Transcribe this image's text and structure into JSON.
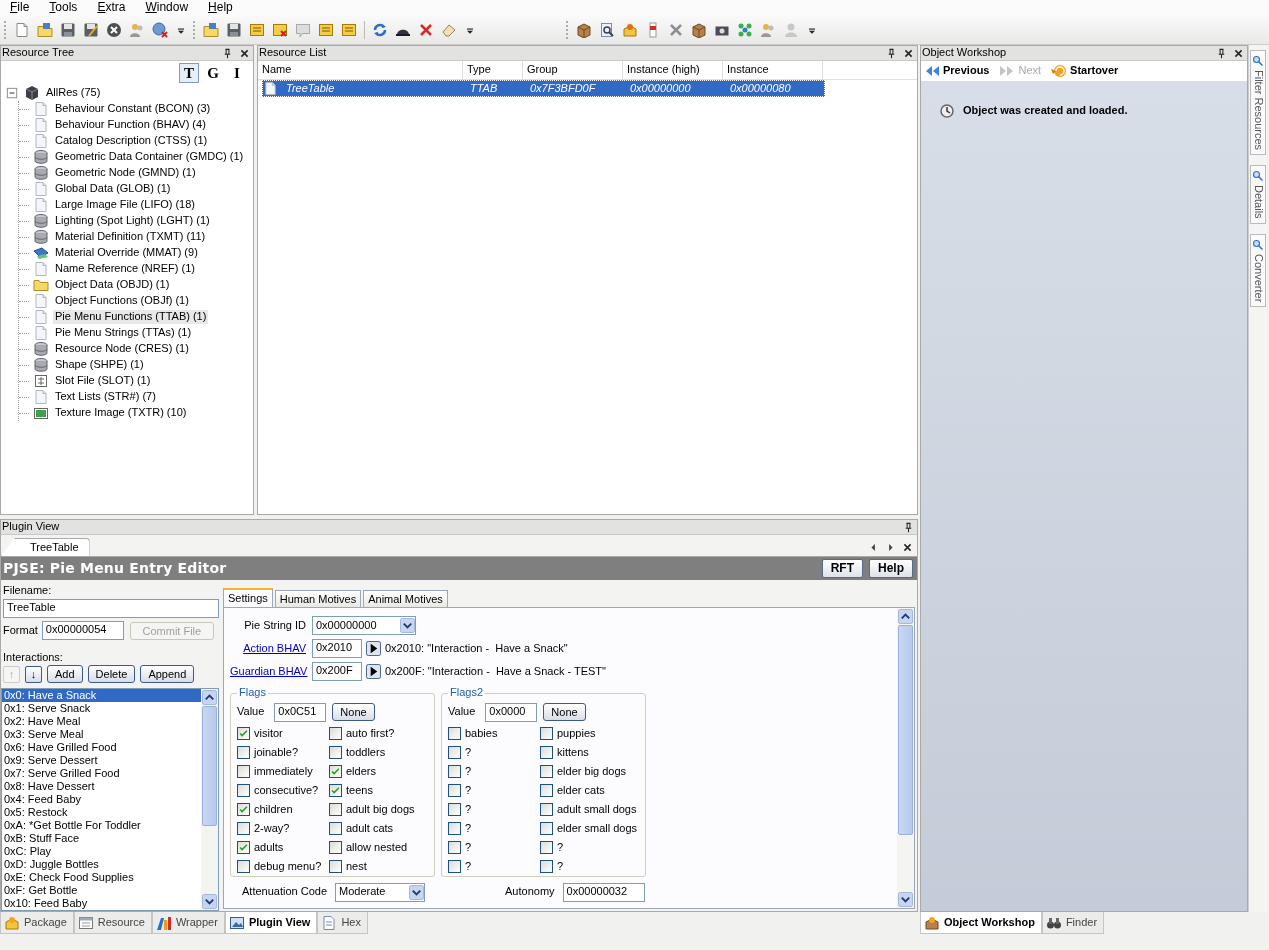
{
  "menu": [
    "File",
    "Tools",
    "Extra",
    "Window",
    "Help"
  ],
  "resource_tree": {
    "title": "Resource Tree",
    "view_buttons": [
      {
        "label": "T",
        "selected": true
      },
      {
        "label": "G",
        "selected": false
      },
      {
        "label": "I",
        "selected": false
      }
    ],
    "root": {
      "label": "AllRes (75)",
      "expanded": true,
      "children": [
        {
          "label": "Behaviour Constant (BCON) (3)",
          "kind": "document",
          "selected": false
        },
        {
          "label": "Behaviour Function (BHAV) (4)",
          "kind": "document",
          "selected": false
        },
        {
          "label": "Catalog Description (CTSS) (1)",
          "kind": "document",
          "selected": false
        },
        {
          "label": "Geometric Data Container (GMDC) (1)",
          "kind": "cylinder",
          "selected": false
        },
        {
          "label": "Geometric Node (GMND) (1)",
          "kind": "cylinder",
          "selected": false
        },
        {
          "label": "Global Data (GLOB) (1)",
          "kind": "document",
          "selected": false
        },
        {
          "label": "Large Image File (LIFO) (18)",
          "kind": "document",
          "selected": false
        },
        {
          "label": "Lighting (Spot Light) (LGHT) (1)",
          "kind": "cylinder",
          "selected": false
        },
        {
          "label": "Material Definition (TXMT) (11)",
          "kind": "cylinder",
          "selected": false
        },
        {
          "label": "Material Override (MMAT) (9)",
          "kind": "material",
          "selected": false
        },
        {
          "label": "Name Reference (NREF) (1)",
          "kind": "document",
          "selected": false
        },
        {
          "label": "Object Data (OBJD) (1)",
          "kind": "folder",
          "selected": false
        },
        {
          "label": "Object Functions (OBJf) (1)",
          "kind": "document",
          "selected": false
        },
        {
          "label": "Pie Menu Functions (TTAB) (1)",
          "kind": "document",
          "selected": true
        },
        {
          "label": "Pie Menu Strings (TTAs) (1)",
          "kind": "document",
          "selected": false
        },
        {
          "label": "Resource Node (CRES) (1)",
          "kind": "cylinder",
          "selected": false
        },
        {
          "label": "Shape (SHPE) (1)",
          "kind": "cylinder",
          "selected": false
        },
        {
          "label": "Slot File (SLOT) (1)",
          "kind": "grid",
          "selected": false
        },
        {
          "label": "Text Lists (STR#) (7)",
          "kind": "document",
          "selected": false
        },
        {
          "label": "Texture Image (TXTR) (10)",
          "kind": "picture",
          "selected": false
        }
      ]
    }
  },
  "resource_list": {
    "title": "Resource List",
    "columns": [
      "Name",
      "Type",
      "Group",
      "Instance (high)",
      "Instance"
    ],
    "rows": [
      {
        "cells": [
          "TreeTable",
          "TTAB",
          "0x7F3BFD0F",
          "0x00000000",
          "0x00000080"
        ],
        "selected": true
      }
    ]
  },
  "object_workshop": {
    "title": "Object Workshop",
    "nav": [
      {
        "label": "Previous",
        "kind": "back",
        "disabled": false
      },
      {
        "label": "Next",
        "kind": "forward",
        "disabled": true
      },
      {
        "label": "Startover",
        "kind": "restart",
        "disabled": false
      }
    ],
    "message": "Object was created and loaded."
  },
  "side_tabs": [
    "Filter Resources",
    "Details",
    "Converter"
  ],
  "plugin_view": {
    "title": "Plugin View",
    "doc_tabs": [
      {
        "label": "TreeTable",
        "selected": true
      }
    ],
    "editor_title": "PJSE: Pie Menu Entry Editor",
    "header_buttons": [
      "RFT",
      "Help"
    ],
    "filename_label": "Filename:",
    "filename": "TreeTable",
    "format_label": "Format",
    "format": "0x00000054",
    "commit_button": {
      "label": "Commit File",
      "disabled": true
    },
    "interactions_label": "Interactions:",
    "move_buttons": [
      {
        "label": "↑",
        "disabled": true
      },
      {
        "label": "↓",
        "disabled": false
      }
    ],
    "action_buttons": [
      "Add",
      "Delete",
      "Append"
    ],
    "interactions": [
      {
        "label": "0x0: Have a Snack",
        "selected": true
      },
      {
        "label": "0x1: Serve Snack",
        "selected": false
      },
      {
        "label": "0x2: Have Meal",
        "selected": false
      },
      {
        "label": "0x3: Serve Meal",
        "selected": false
      },
      {
        "label": "0x6: Have Grilled Food",
        "selected": false
      },
      {
        "label": "0x9: Serve Dessert",
        "selected": false
      },
      {
        "label": "0x7: Serve Grilled Food",
        "selected": false
      },
      {
        "label": "0x8: Have Dessert",
        "selected": false
      },
      {
        "label": "0x4: Feed Baby",
        "selected": false
      },
      {
        "label": "0x5: Restock",
        "selected": false
      },
      {
        "label": "0xA: *Get Bottle For Toddler",
        "selected": false
      },
      {
        "label": "0xB: Stuff Face",
        "selected": false
      },
      {
        "label": "0xC: Play",
        "selected": false
      },
      {
        "label": "0xD: Juggle Bottles",
        "selected": false
      },
      {
        "label": "0xE: Check Food Supplies",
        "selected": false
      },
      {
        "label": "0xF: Get Bottle",
        "selected": false
      },
      {
        "label": "0x10: Feed Baby",
        "selected": false
      }
    ],
    "tabs": [
      {
        "label": "Settings",
        "selected": true
      },
      {
        "label": "Human Motives",
        "selected": false
      },
      {
        "label": "Animal Motives",
        "selected": false
      }
    ],
    "settings": {
      "pie_string": {
        "label": "Pie String ID",
        "value": "0x00000000"
      },
      "bhavs": [
        {
          "label": "Action BHAV",
          "value": "0x2010",
          "description": "0x2010: \"Interaction -  Have a Snack\""
        },
        {
          "label": "Guardian BHAV",
          "value": "0x200F",
          "description": "0x200F: \"Interaction -  Have a Snack - TEST\""
        }
      ],
      "flag_groups": [
        {
          "title": "Flags",
          "value_label": "Value",
          "value": "0x0C51",
          "button": "None",
          "items": [
            {
              "label": "visitor",
              "checked": true
            },
            {
              "label": "auto first?",
              "checked": false
            },
            {
              "label": "joinable?",
              "checked": false
            },
            {
              "label": "toddlers",
              "checked": false
            },
            {
              "label": "immediately",
              "checked": false
            },
            {
              "label": "elders",
              "checked": true
            },
            {
              "label": "consecutive?",
              "checked": false
            },
            {
              "label": "teens",
              "checked": true
            },
            {
              "label": "children",
              "checked": true
            },
            {
              "label": "adult big dogs",
              "checked": false
            },
            {
              "label": "2-way?",
              "checked": false
            },
            {
              "label": "adult cats",
              "checked": false
            },
            {
              "label": "adults",
              "checked": true
            },
            {
              "label": "allow nested",
              "checked": false
            },
            {
              "label": "debug menu?",
              "checked": false
            },
            {
              "label": "nest",
              "checked": false
            }
          ]
        },
        {
          "title": "Flags2",
          "value_label": "Value",
          "value": "0x0000",
          "button": "None",
          "items": [
            {
              "label": "babies",
              "checked": false
            },
            {
              "label": "puppies",
              "checked": false
            },
            {
              "label": "?",
              "checked": false
            },
            {
              "label": "kittens",
              "checked": false
            },
            {
              "label": "?",
              "checked": false
            },
            {
              "label": "elder big dogs",
              "checked": false
            },
            {
              "label": "?",
              "checked": false
            },
            {
              "label": "elder cats",
              "checked": false
            },
            {
              "label": "?",
              "checked": false
            },
            {
              "label": "adult small dogs",
              "checked": false
            },
            {
              "label": "?",
              "checked": false
            },
            {
              "label": "elder small dogs",
              "checked": false
            },
            {
              "label": "?",
              "checked": false
            },
            {
              "label": "?",
              "checked": false
            },
            {
              "label": "?",
              "checked": false
            },
            {
              "label": "?",
              "checked": false
            }
          ]
        }
      ],
      "attenuation": {
        "label": "Attenuation Code",
        "value": "Moderate"
      },
      "autonomy": {
        "label": "Autonomy",
        "value": "0x00000032"
      }
    }
  },
  "bottom_tabs": [
    {
      "label": "Package",
      "kind": "package",
      "selected": false
    },
    {
      "label": "Resource",
      "kind": "resource",
      "selected": false
    },
    {
      "label": "Wrapper",
      "kind": "wrapper",
      "selected": false
    },
    {
      "label": "Plugin View",
      "kind": "plugin",
      "selected": true
    },
    {
      "label": "Hex",
      "kind": "hex",
      "selected": false
    }
  ],
  "workshop_tabs": [
    {
      "label": "Object Workshop",
      "kind": "workshop",
      "selected": true
    },
    {
      "label": "Finder",
      "kind": "finder",
      "selected": false
    }
  ]
}
